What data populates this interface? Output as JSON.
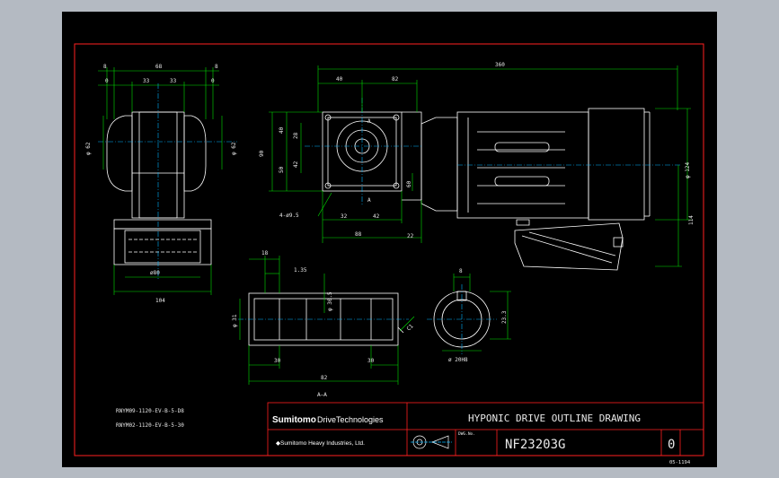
{
  "colors": {
    "background": "#b4bac2",
    "sheet": "#000000",
    "border": "#ff2020",
    "outline": "#ffffff",
    "dimension": "#00e000",
    "centerline": "#00b4ff",
    "text": "#e8e8e8"
  },
  "dimensions": {
    "top_8_left": "8",
    "top_68": "68",
    "top_8_right": "8",
    "top_0_left": "0",
    "top_33_a": "33",
    "top_33_b": "33",
    "top_0_right": "0",
    "dia_62_left": "φ 62",
    "dia_62_right": "φ 62",
    "base_80": "ø80",
    "base_104": "104",
    "overall_360": "360",
    "front_40": "40",
    "front_82": "82",
    "front_90": "90",
    "front_40b": "40",
    "front_28": "28",
    "front_50": "50",
    "front_42": "42",
    "front_60": "60",
    "front_32": "32",
    "front_42b": "42",
    "front_88": "88",
    "front_22": "22",
    "front_holes": "4-ø9.5",
    "motor_dia": "φ 124",
    "motor_114": "114",
    "section_18": "18",
    "section_135": "1.35",
    "section_dia30": "φ 30.5",
    "section_dia31": "φ 31",
    "section_30a": "30",
    "section_30b": "30",
    "section_82": "82",
    "section_c1": "C1",
    "bore_8": "8",
    "bore_233": "23.3",
    "bore_dia": "ø 20H8"
  },
  "labels": {
    "section_a_top": "A",
    "section_a_bottom": "A",
    "section_aa": "A—A",
    "part_no_1": "RNYM09-1120-EV-B-5-D8",
    "part_no_2": "RNYM02-1120-EV-B-5-30",
    "sheet_code": "05-1194"
  },
  "title_block": {
    "brand_main": "Sumitomo",
    "brand_sub": "DriveTechnologies",
    "company": "◆Sumitomo Heavy Industries, Ltd.",
    "drawing_title": "HYPONIC DRIVE OUTLINE DRAWING",
    "dwg_no_label": "DWG.No.",
    "drawing_number": "NF23203G",
    "revision": "0"
  }
}
